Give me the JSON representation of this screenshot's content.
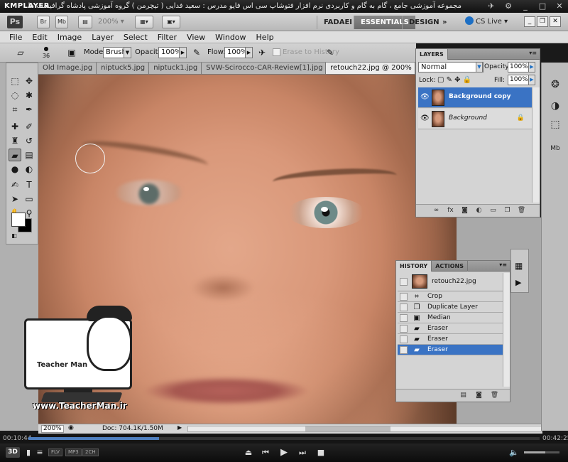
{
  "player": {
    "logo": "KMPLAYER",
    "caption": "مجموعه آموزشی جامع ، گام به گام و کاربردی نرم افزار فتوشاپ سی اس فایو  مدرس : سعید فدایی ( تیچرمن ) گروه آموزشی پادشاه گرافیست ها",
    "time_elapsed": "00:10:44",
    "time_total": "00:42:25",
    "progress": 0.255,
    "volume": 0.6,
    "badges": [
      "FLV",
      "MP3",
      "2CH"
    ],
    "button_3d": "3D"
  },
  "app": {
    "logo": "Ps",
    "bridge_label": "Br",
    "minibridge_label": "Mb",
    "zoom": "200%",
    "workspaces": [
      "FADAEI",
      "ESSENTIALS",
      "DESIGN"
    ],
    "active_workspace": "ESSENTIALS",
    "cs_live": "CS Live"
  },
  "menu": [
    "File",
    "Edit",
    "Image",
    "Layer",
    "Select",
    "Filter",
    "View",
    "Window",
    "Help"
  ],
  "options": {
    "brush_size": "36",
    "mode_label": "Mode:",
    "mode_value": "Brush",
    "opacity_label": "Opacity:",
    "opacity_value": "100%",
    "flow_label": "Flow:",
    "flow_value": "100%",
    "erase_to_history": "Erase to History"
  },
  "tabs": [
    "Old Image.jpg",
    "niptuck5.jpg",
    "niptuck1.jpg",
    "SVW-Scirocco-CAR-Review[1].jpg",
    "retouch22.jpg @ 200%"
  ],
  "status": {
    "zoom": "200%",
    "doc": "Doc: 704.1K/1.50M"
  },
  "layers_panel": {
    "title": "LAYERS",
    "blend_mode": "Normal",
    "opacity_label": "Opacity:",
    "opacity": "100%",
    "lock_label": "Lock:",
    "fill_label": "Fill:",
    "fill": "100%",
    "layers": [
      {
        "name": "Background copy",
        "selected": true
      },
      {
        "name": "Background",
        "selected": false,
        "locked": true
      }
    ]
  },
  "history_panel": {
    "tabs": [
      "HISTORY",
      "ACTIONS"
    ],
    "snapshot": "retouch22.jpg",
    "states": [
      "Crop",
      "Duplicate Layer",
      "Median",
      "Eraser",
      "Eraser",
      "Eraser"
    ],
    "selected_index": 5
  },
  "watermark": {
    "brand": "Teacher Man",
    "url": "www.TeacherMan.ir"
  }
}
